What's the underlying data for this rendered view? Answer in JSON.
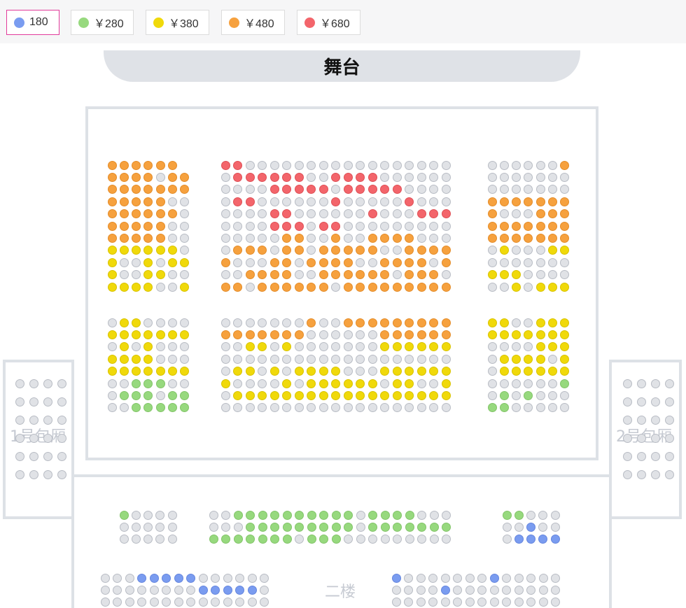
{
  "legend": [
    {
      "label": "180",
      "color": "#7a9cf0",
      "active": true
    },
    {
      "label": "￥280",
      "color": "#97d97e",
      "active": false
    },
    {
      "label": "￥380",
      "color": "#f0d90a",
      "active": false
    },
    {
      "label": "￥480",
      "color": "#f6a13e",
      "active": false
    },
    {
      "label": "￥680",
      "color": "#f3656b",
      "active": false
    }
  ],
  "stage_label": "舞台",
  "box1_label": "1号包厢",
  "box2_label": "2号包厢",
  "floor2_label": "二楼",
  "price_legend_key": {
    "0": "unavailable",
    "1": "180",
    "2": "￥280",
    "3": "￥380",
    "4": "￥480",
    "5": "￥680"
  },
  "seat_blocks": {
    "main_upper_left": [
      "444444",
      "4444044",
      "4444444",
      "4444400",
      "4444440",
      "4444400",
      "4444400",
      "3333330",
      "3003033",
      "3003300",
      "3333003"
    ],
    "main_upper_center": [
      "5500000000000000000",
      "0555555005555000000",
      "0000555550555550000",
      "0550000005000005000",
      "0000550000005000555",
      "0000555055000000000",
      "0000044004004444000",
      "0444044044444004444",
      "4000440444400444404",
      "0044440044444404440",
      "4404444440444444444"
    ],
    "main_upper_right": [
      "0000004",
      "0000000",
      "0000000",
      "4444444",
      "4000444",
      "4444444",
      "4444444",
      "0300033",
      "0000000",
      "3330000",
      "0030333"
    ],
    "main_lower_left": [
      "0330000",
      "3333333",
      "0303000",
      "3333000",
      "3333333",
      "0022200",
      "0222022",
      "0022222"
    ],
    "main_lower_center": [
      "0000000400444444444",
      "4444444000000444444",
      "0033030000000333333",
      "0000000000000000000",
      "0330303333000333333",
      "3000030333333033003",
      "0333333333333333333",
      "0000000000000000000"
    ],
    "main_lower_right": [
      "3300333",
      "3333333",
      "0000333",
      "0333303",
      "0333333",
      "0000002",
      "0202000",
      "2200000"
    ],
    "box1": [
      "0000",
      "0000",
      "0000",
      "0000",
      "0000",
      "0000"
    ],
    "box2": [
      "0000",
      "0000",
      "0000",
      "0000",
      "0000",
      "0000"
    ],
    "floor2_left_row1": [
      "20000",
      "00000",
      "00000"
    ],
    "floor2_center": [
      "00222222222202222000",
      "00022222222202222222",
      "22222220222000000000"
    ],
    "floor2_right": [
      "22000",
      "00100",
      "01111"
    ],
    "floor2_bottom_left": [
      "00011111000000",
      "00000000111110",
      "00000000000000"
    ],
    "floor2_bottom_right": [
      "10000000100000",
      "00001000000000",
      "00000000000000"
    ]
  }
}
